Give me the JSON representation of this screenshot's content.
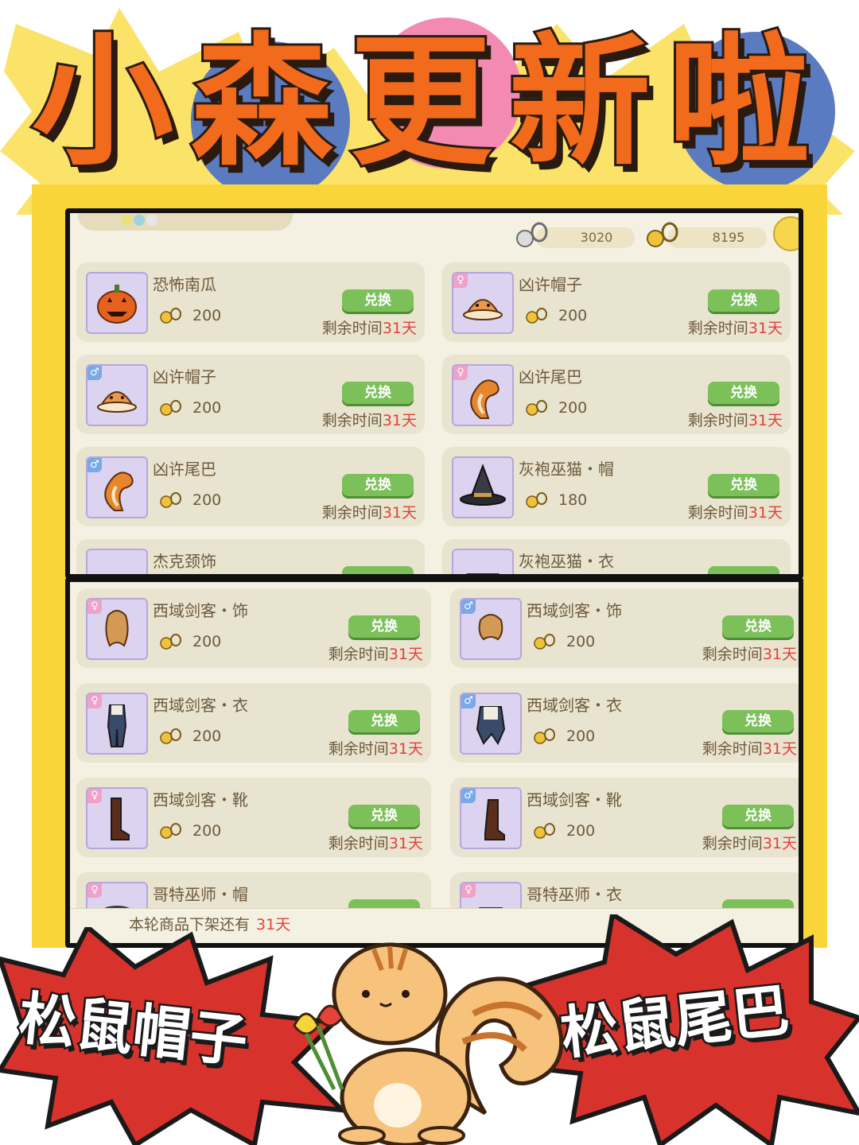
{
  "title": {
    "chars": [
      "小",
      "森",
      "更",
      "新",
      "啦"
    ],
    "color": "#f26a1c",
    "circle_colors": [
      "#5a7bbf",
      "#f38ab2",
      "#5a7bbf"
    ],
    "burst_color": "#fbe36a"
  },
  "currency": {
    "silver": "3020",
    "gold": "8195"
  },
  "panel_top": {
    "cards": [
      {
        "name": "恐怖南瓜",
        "price": "200",
        "button": "兑换",
        "remain_label": "剩余时间",
        "remain_days": "31天",
        "gender": "",
        "icon": "pumpkin-icon"
      },
      {
        "name": "凶许帽子",
        "price": "200",
        "button": "兑换",
        "remain_label": "剩余时间",
        "remain_days": "31天",
        "gender": "♀",
        "icon": "squirrel-hat-icon"
      },
      {
        "name": "凶许帽子",
        "price": "200",
        "button": "兑换",
        "remain_label": "剩余时间",
        "remain_days": "31天",
        "gender": "♂",
        "icon": "squirrel-hat-icon"
      },
      {
        "name": "凶许尾巴",
        "price": "200",
        "button": "兑换",
        "remain_label": "剩余时间",
        "remain_days": "31天",
        "gender": "♀",
        "icon": "squirrel-tail-icon"
      },
      {
        "name": "凶许尾巴",
        "price": "200",
        "button": "兑换",
        "remain_label": "剩余时间",
        "remain_days": "31天",
        "gender": "♂",
        "icon": "squirrel-tail-icon"
      },
      {
        "name": "灰袍巫猫・帽",
        "price": "180",
        "button": "兑换",
        "remain_label": "剩余时间",
        "remain_days": "31天",
        "gender": "",
        "icon": "witch-hat-icon"
      },
      {
        "name": "杰克颈饰",
        "icon": "neck-ornament-icon"
      },
      {
        "name": "灰袍巫猫・衣",
        "icon": "robe-icon"
      }
    ]
  },
  "panel_bottom": {
    "cards": [
      {
        "name": "西域剑客・饰",
        "price": "200",
        "button": "兑换",
        "remain_label": "剩余时间",
        "remain_days": "31天",
        "gender": "♀",
        "icon": "hair-ornament-icon"
      },
      {
        "name": "西域剑客・饰",
        "price": "200",
        "button": "兑换",
        "remain_label": "剩余时间",
        "remain_days": "31天",
        "gender": "♂",
        "icon": "hair-ornament-icon"
      },
      {
        "name": "西域剑客・衣",
        "price": "200",
        "button": "兑换",
        "remain_label": "剩余时间",
        "remain_days": "31天",
        "gender": "♀",
        "icon": "outfit-icon"
      },
      {
        "name": "西域剑客・衣",
        "price": "200",
        "button": "兑换",
        "remain_label": "剩余时间",
        "remain_days": "31天",
        "gender": "♂",
        "icon": "outfit-icon"
      },
      {
        "name": "西域剑客・靴",
        "price": "200",
        "button": "兑换",
        "remain_label": "剩余时间",
        "remain_days": "31天",
        "gender": "♀",
        "icon": "boots-icon"
      },
      {
        "name": "西域剑客・靴",
        "price": "200",
        "button": "兑换",
        "remain_label": "剩余时间",
        "remain_days": "31天",
        "gender": "♂",
        "icon": "boots-icon"
      },
      {
        "name": "哥特巫师・帽",
        "gender": "♀",
        "icon": "goth-hat-icon"
      },
      {
        "name": "哥特巫师・衣",
        "gender": "♀",
        "icon": "goth-robe-icon"
      }
    ],
    "footer_label": "本轮商品下架还有",
    "footer_days": "31天"
  },
  "stickers": {
    "left": "松鼠帽子",
    "right": "松鼠尾巴",
    "color": "#d8322c"
  }
}
